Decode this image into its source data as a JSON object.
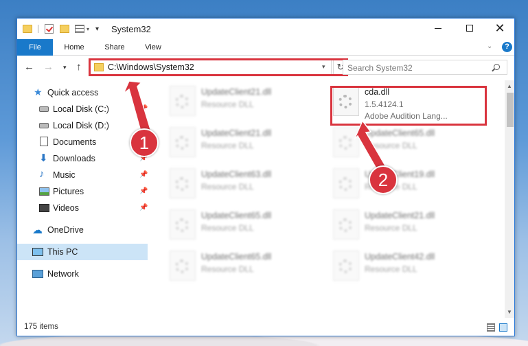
{
  "window": {
    "title": "System32"
  },
  "ribbon": {
    "tabs": [
      "File",
      "Home",
      "Share",
      "View"
    ],
    "help": "?"
  },
  "nav": {
    "address": "C:\\Windows\\System32",
    "search_placeholder": "Search System32"
  },
  "sidebar": {
    "items": [
      {
        "label": "Quick access",
        "icon": "star-icon"
      },
      {
        "label": "Local Disk (C:)",
        "icon": "disk-icon"
      },
      {
        "label": "Local Disk (D:)",
        "icon": "disk-icon"
      },
      {
        "label": "Documents",
        "icon": "documents-icon"
      },
      {
        "label": "Downloads",
        "icon": "download-icon"
      },
      {
        "label": "Music",
        "icon": "music-icon"
      },
      {
        "label": "Pictures",
        "icon": "pictures-icon"
      },
      {
        "label": "Videos",
        "icon": "videos-icon"
      },
      {
        "label": "OneDrive",
        "icon": "cloud-icon"
      },
      {
        "label": "This PC",
        "icon": "computer-icon"
      },
      {
        "label": "Network",
        "icon": "network-icon"
      }
    ]
  },
  "files": {
    "left": [
      {
        "name": "UpdateClient21.dll",
        "type": "Resource DLL"
      },
      {
        "name": "UpdateClient21.dll",
        "type": "Resource DLL"
      },
      {
        "name": "UpdateClient63.dll",
        "type": "Resource DLL"
      },
      {
        "name": "UpdateClient65.dll",
        "type": "Resource DLL"
      },
      {
        "name": "UpdateClient65.dll",
        "type": "Resource DLL"
      }
    ],
    "right_highlight": {
      "name": "cda.dll",
      "type": "1.5.4124.1",
      "desc": "Adobe Audition Lang..."
    },
    "right": [
      {
        "name": "UpdateClient65.dll",
        "type": "Resource DLL"
      },
      {
        "name": "UpdateClient19.dll",
        "type": "Resource DLL"
      },
      {
        "name": "UpdateClient21.dll",
        "type": "Resource DLL"
      },
      {
        "name": "UpdateClient42.dll",
        "type": "Resource DLL"
      }
    ]
  },
  "status": {
    "count": "175 items"
  },
  "callouts": [
    "1",
    "2"
  ],
  "colors": {
    "accent": "#1979ca",
    "highlight": "#d9343e"
  }
}
